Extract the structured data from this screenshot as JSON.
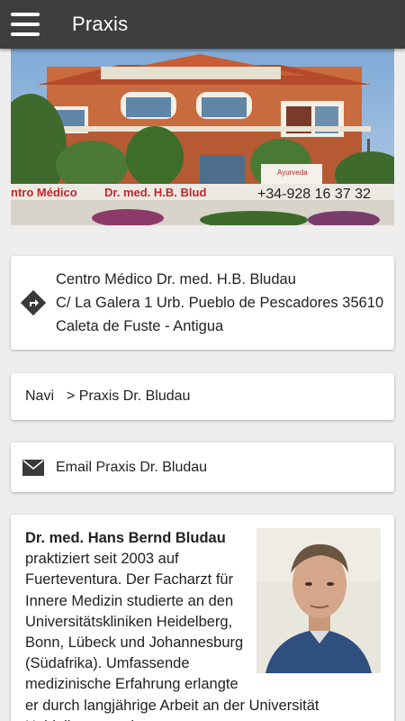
{
  "appbar": {
    "title": "Praxis"
  },
  "hero": {
    "sign_left": "ntro Médico",
    "sign_doctor": "Dr. med. H.B. Blud",
    "sign_phone": "+34-928 16 37 32",
    "ayurveda_sign": "Ayurveda"
  },
  "address": {
    "line1": "Centro Médico Dr. med. H.B. Bludau",
    "line2": "C/ La Galera 1 Urb. Pueblo de Pescadores 35610",
    "line3": "Caleta de Fuste - Antigua",
    "icon": "directions-icon"
  },
  "navi": {
    "label": "Navi",
    "link": "> Praxis Dr. Bludau"
  },
  "email": {
    "icon": "envelope-icon",
    "label": "Email Praxis Dr. Bludau"
  },
  "bio": {
    "name": "Dr. med. Hans Bernd Bludau",
    "text": "praktiziert seit 2003 auf Fuerteventura. Der Facharzt für Innere Medizin studierte an den Universitätskliniken Heidelberg, Bonn, Lübeck und Johannesburg (Südafrika). Umfassende medizinische Erfahrung erlangte er durch langjährige Arbeit an der Universität Heidelberg, an den"
  },
  "colors": {
    "appbar": "#3d3d3d",
    "background": "#eeeeee",
    "card": "#ffffff",
    "icon": "#3a3a3a"
  }
}
